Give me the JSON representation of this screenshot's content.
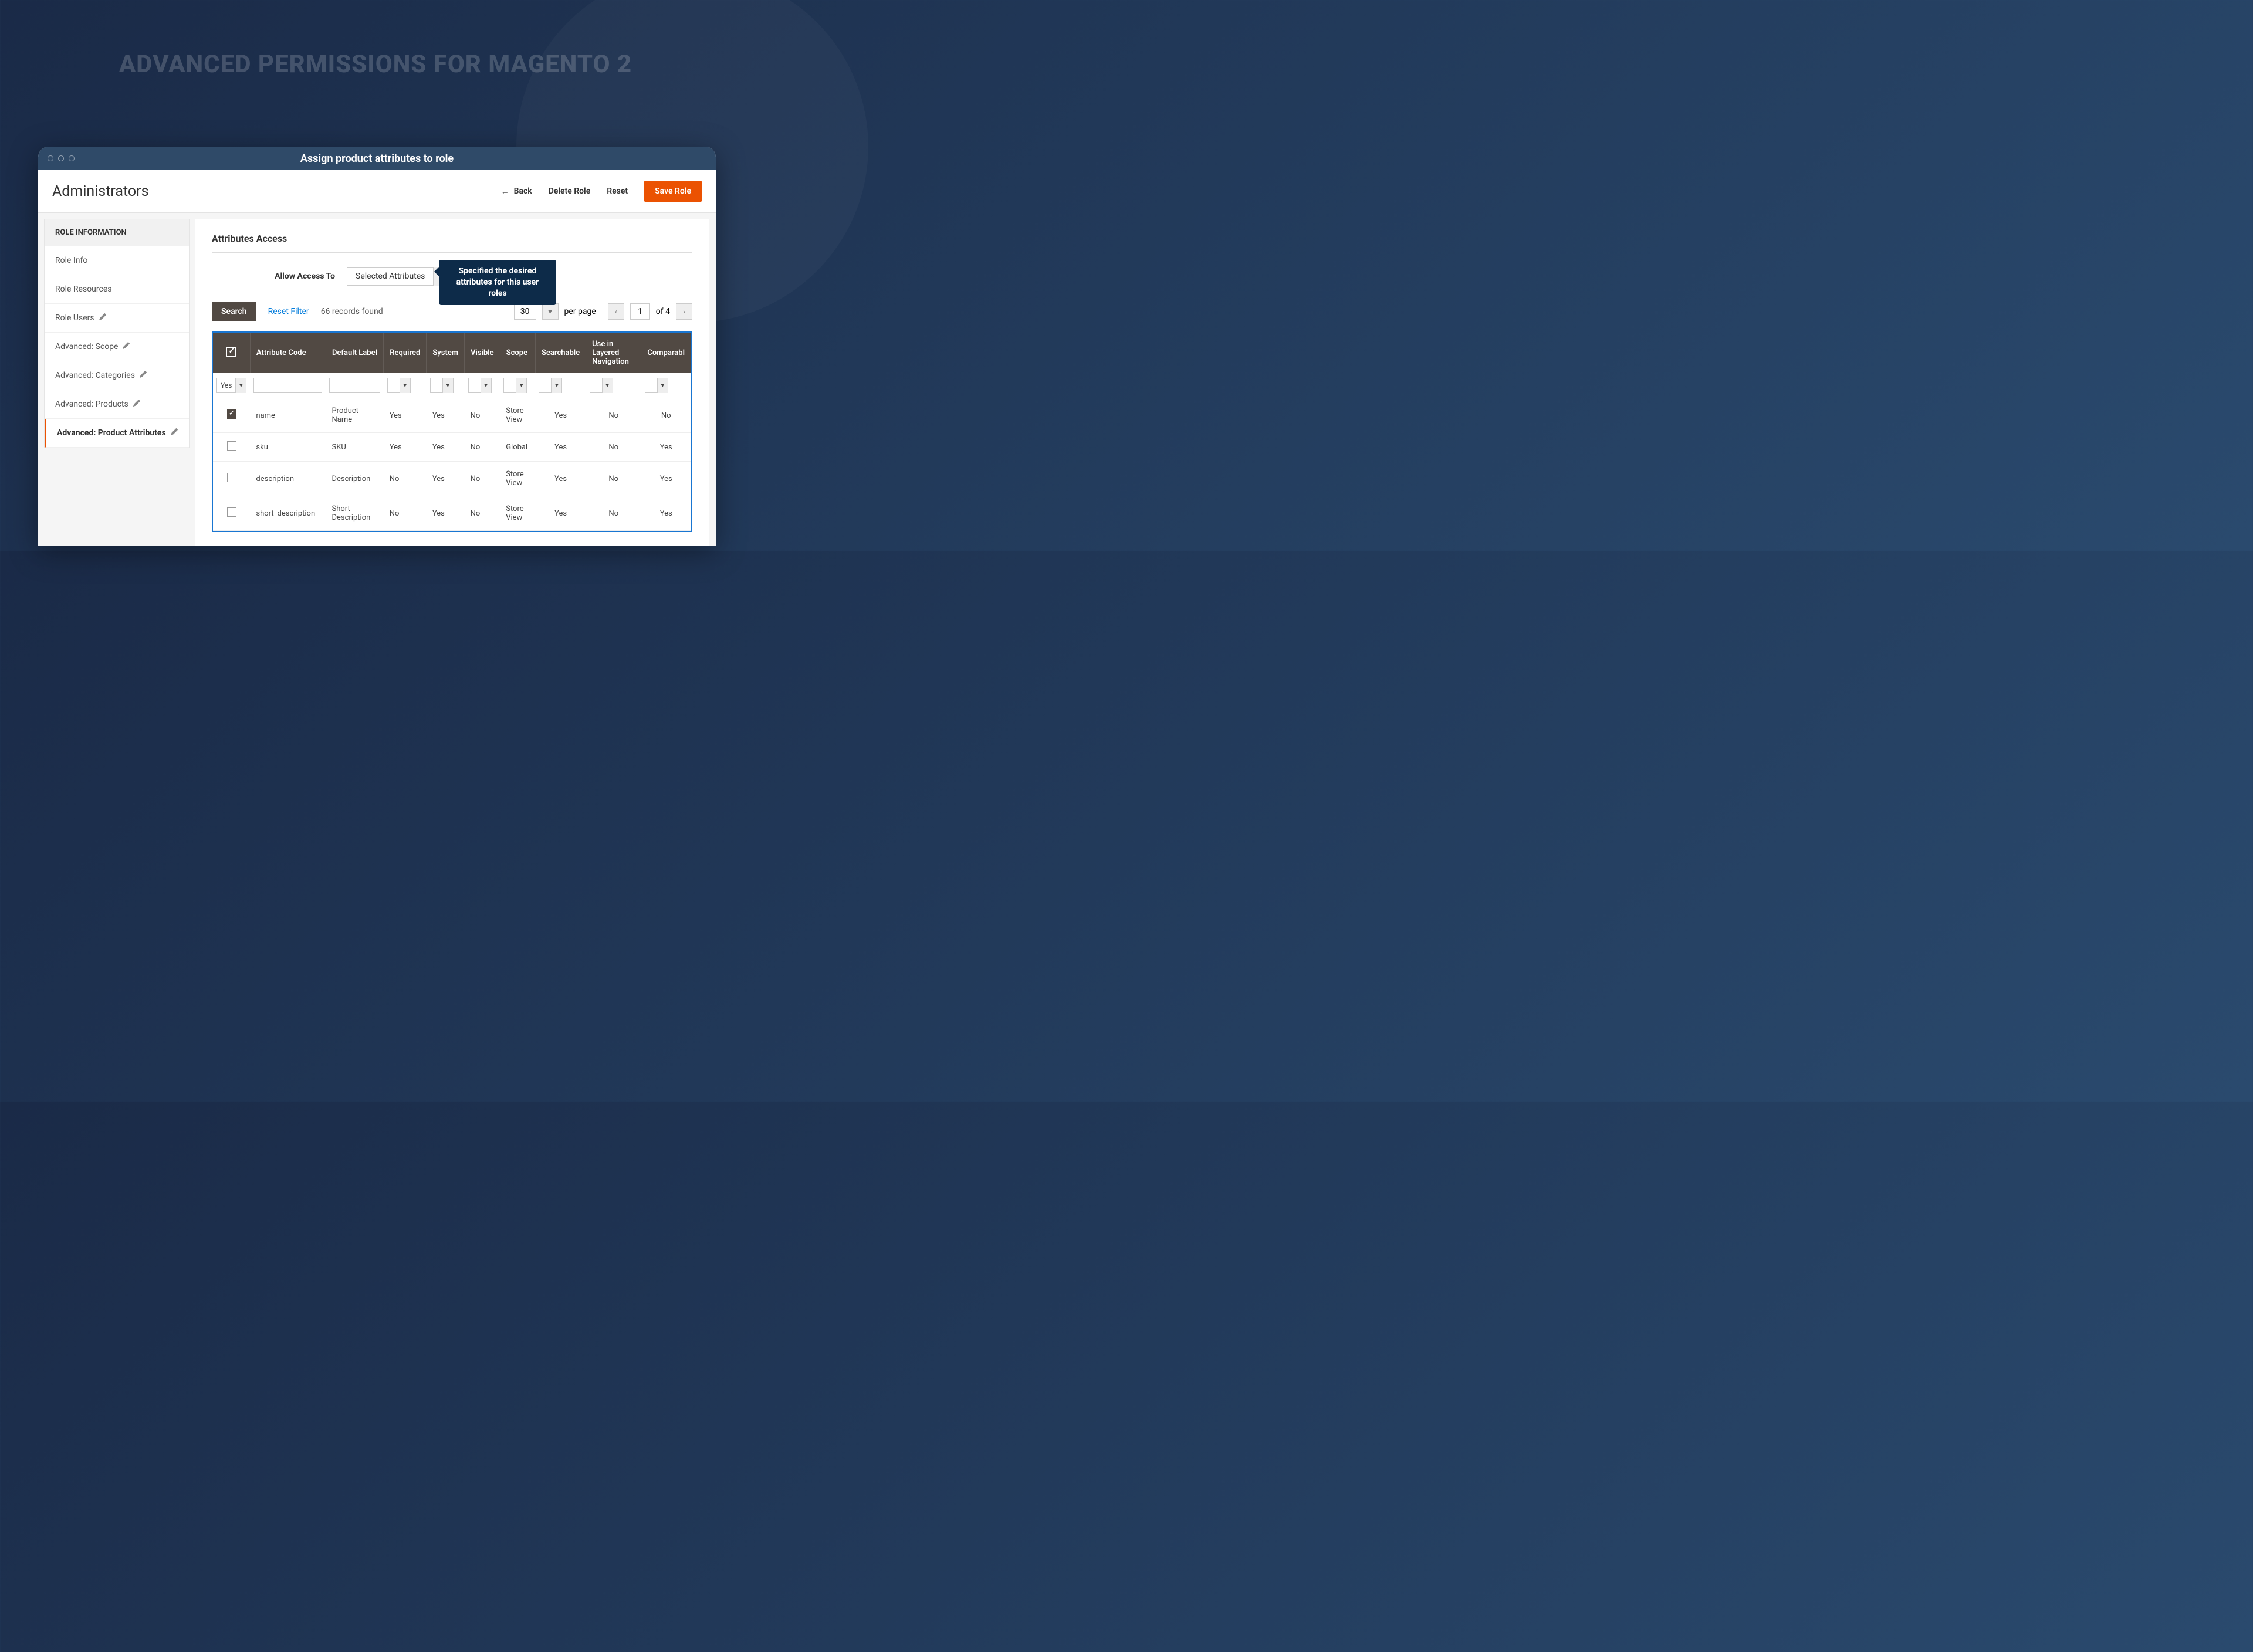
{
  "hero_title": "ADVANCED PERMISSIONS FOR MAGENTO 2",
  "window_title": "Assign product attributes to role",
  "page_title": "Administrators",
  "header": {
    "back": "Back",
    "delete": "Delete Role",
    "reset": "Reset",
    "save": "Save Role"
  },
  "sidebar": {
    "heading": "ROLE INFORMATION",
    "items": [
      {
        "label": "Role Info",
        "editable": false,
        "active": false
      },
      {
        "label": "Role Resources",
        "editable": false,
        "active": false
      },
      {
        "label": "Role Users",
        "editable": true,
        "active": false
      },
      {
        "label": "Advanced: Scope",
        "editable": true,
        "active": false
      },
      {
        "label": "Advanced: Categories",
        "editable": true,
        "active": false
      },
      {
        "label": "Advanced: Products",
        "editable": true,
        "active": false
      },
      {
        "label": "Advanced: Product Attributes",
        "editable": true,
        "active": true
      }
    ]
  },
  "section_title": "Attributes Access",
  "access": {
    "label": "Allow Access To",
    "value": "Selected Attributes"
  },
  "callout": "Specified the desired attributes for this user roles",
  "toolbar": {
    "search": "Search",
    "reset_filter": "Reset Filter",
    "records": "66 records found",
    "page_size": "30",
    "per_page": "per page",
    "current_page": "1",
    "total_pages": "of 4"
  },
  "columns": [
    "",
    "Attribute Code",
    "Default Label",
    "Required",
    "System",
    "Visible",
    "Scope",
    "Searchable",
    "Use in Layered Navigation",
    "Comparabl"
  ],
  "filter_yes": "Yes",
  "rows": [
    {
      "checked": true,
      "code": "name",
      "label": "Product Name",
      "required": "Yes",
      "system": "Yes",
      "visible": "No",
      "scope": "Store View",
      "searchable": "Yes",
      "layered": "No",
      "comparable": "No"
    },
    {
      "checked": false,
      "code": "sku",
      "label": "SKU",
      "required": "Yes",
      "system": "Yes",
      "visible": "No",
      "scope": "Global",
      "searchable": "Yes",
      "layered": "No",
      "comparable": "Yes"
    },
    {
      "checked": false,
      "code": "description",
      "label": "Description",
      "required": "No",
      "system": "Yes",
      "visible": "No",
      "scope": "Store View",
      "searchable": "Yes",
      "layered": "No",
      "comparable": "Yes"
    },
    {
      "checked": false,
      "code": "short_description",
      "label": "Short Description",
      "required": "No",
      "system": "Yes",
      "visible": "No",
      "scope": "Store View",
      "searchable": "Yes",
      "layered": "No",
      "comparable": "Yes"
    }
  ]
}
